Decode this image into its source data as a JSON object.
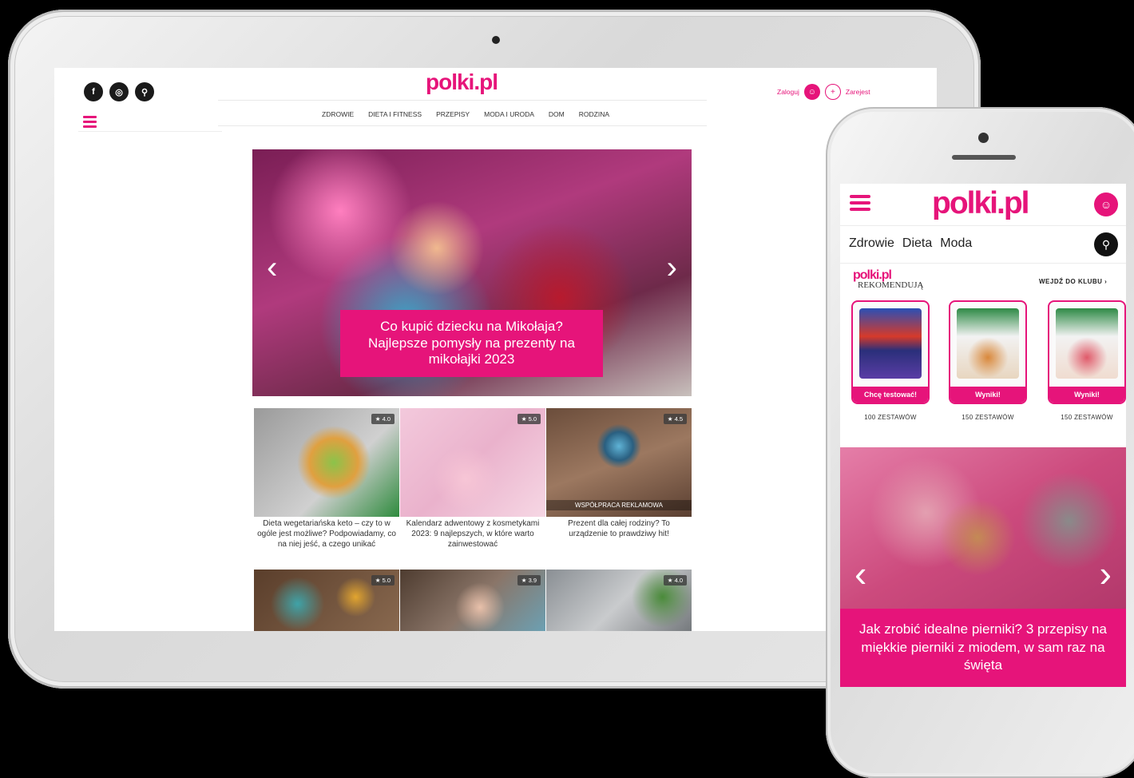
{
  "tablet": {
    "logo": "polki.pl",
    "social": [
      "f",
      "◎",
      "⚲"
    ],
    "nav": [
      "ZDROWIE",
      "DIETA I FITNESS",
      "PRZEPISY",
      "MODA I URODA",
      "DOM",
      "RODZINA"
    ],
    "login_label": "Zaloguj",
    "register_label": "Zarejest",
    "hero": {
      "caption": "Co kupić dziecku na Mikołaja? Najlepsze pomysły na prezenty na mikołajki 2023",
      "prev_arrow": "‹",
      "next_arrow": "›"
    },
    "cards": [
      {
        "title": "Dieta wegetariańska keto – czy to w ogóle jest możliwe? Podpowiadamy, co na niej jeść, a czego unikać",
        "rating": "★ 4.0",
        "sponsor": ""
      },
      {
        "title": "Kalendarz adwentowy z kosmetykami 2023: 9 najlepszych, w które warto zainwestować",
        "rating": "★ 5.0",
        "sponsor": ""
      },
      {
        "title": "Prezent dla całej rodziny? To urządzenie to prawdziwy hit!",
        "rating": "★ 4.5",
        "sponsor": "WSPÓŁPRACA REKLAMOWA"
      },
      {
        "title": "",
        "rating": "★ 5.0",
        "sponsor": ""
      },
      {
        "title": "",
        "rating": "★ 3.9",
        "sponsor": ""
      },
      {
        "title": "",
        "rating": "★ 4.0",
        "sponsor": ""
      }
    ]
  },
  "phone": {
    "logo": "polki.pl",
    "nav": [
      "Zdrowie",
      "Dieta",
      "Moda"
    ],
    "rek_logo": "polki.pl",
    "rek_sub": "REKOMENDUJĄ",
    "club_link": "WEJDŹ DO KLUBU ›",
    "products": [
      {
        "button": "Chcę testować!",
        "count": "100 ZESTAWÓW"
      },
      {
        "button": "Wyniki!",
        "count": "150 ZESTAWÓW"
      },
      {
        "button": "Wyniki!",
        "count": "150 ZESTAWÓW"
      }
    ],
    "hero_caption": "Jak zrobić idealne pierniki? 3 przepisy na miękkie pierniki z miodem, w sam raz na święta",
    "prev_arrow": "‹",
    "next_arrow": "›"
  },
  "colors": {
    "brand": "#e6147a",
    "dark": "#1a1a1a"
  }
}
